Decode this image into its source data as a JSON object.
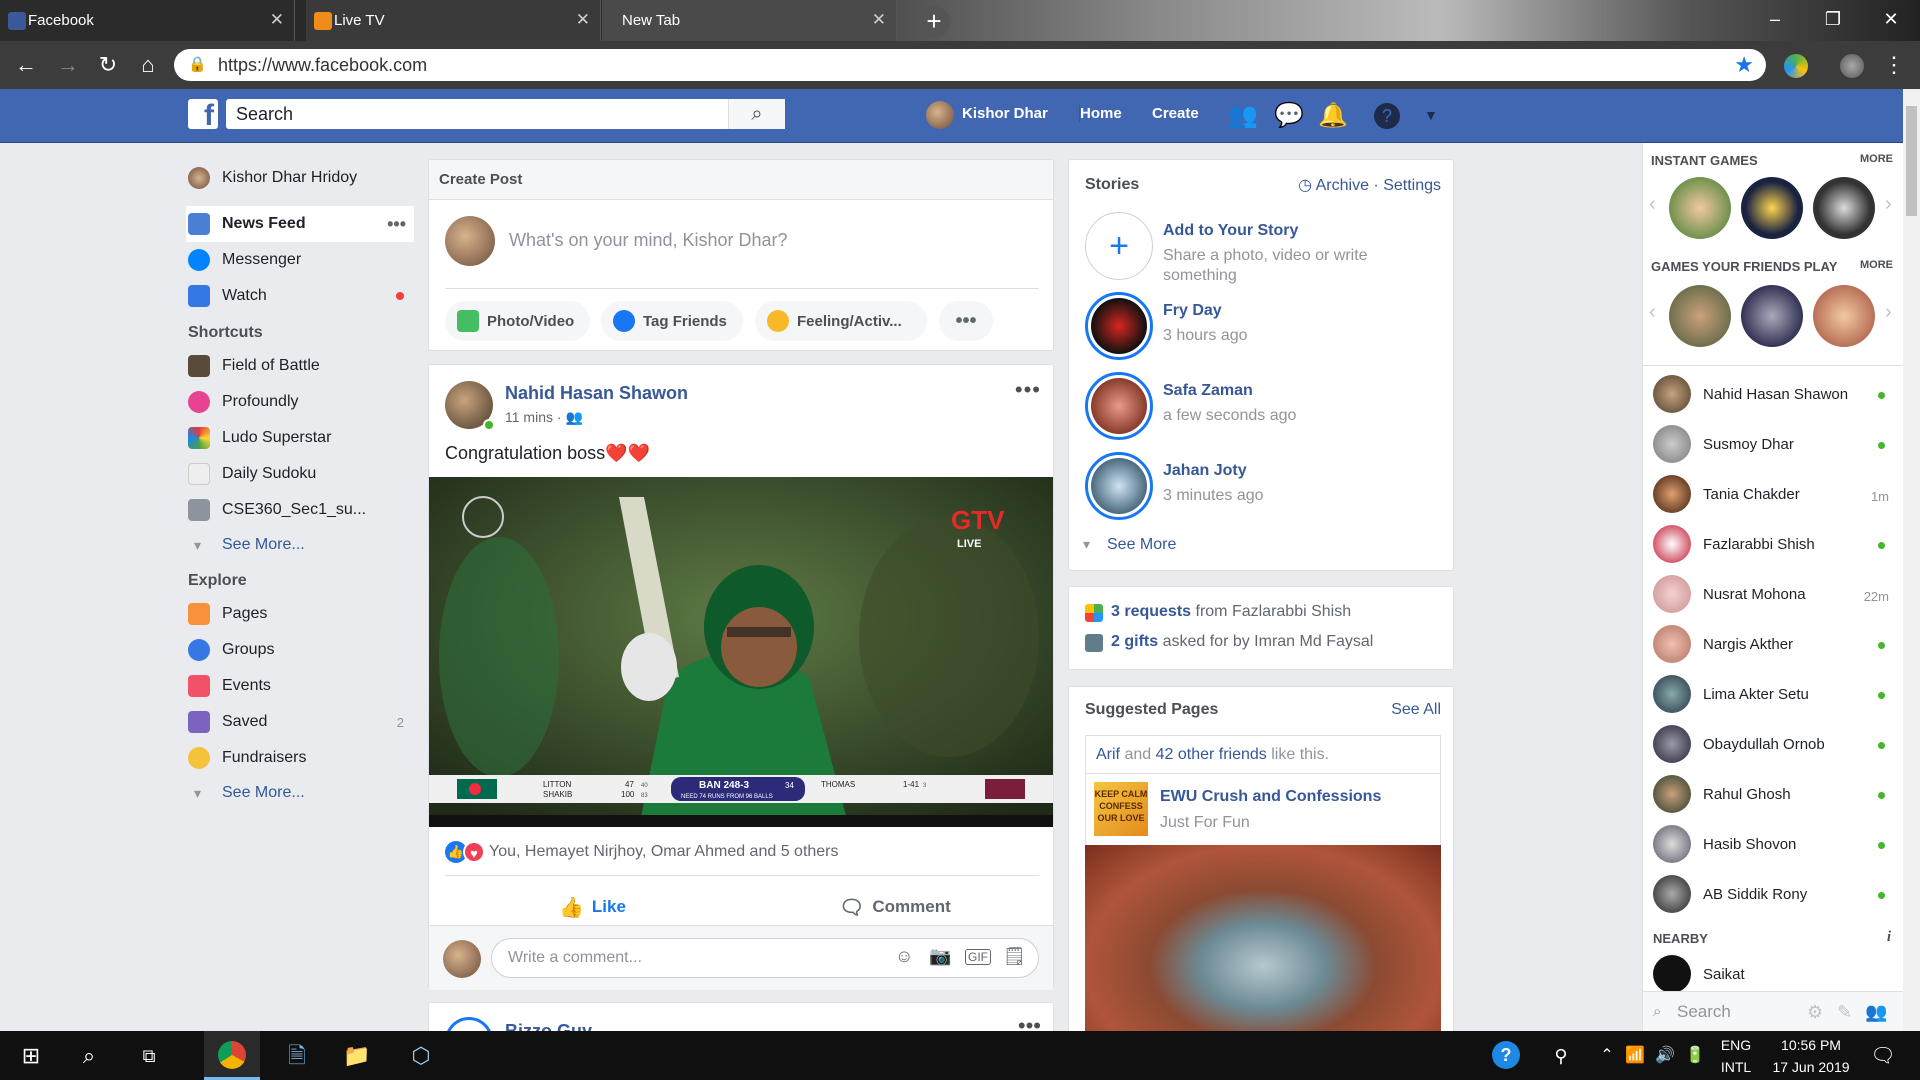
{
  "browser": {
    "tabs": [
      {
        "title": "Facebook",
        "active": true
      },
      {
        "title": "Live TV",
        "active": false
      },
      {
        "title": "New Tab",
        "active": false
      }
    ],
    "url": "https://www.facebook.com"
  },
  "header": {
    "search_placeholder": "Search",
    "user_name": "Kishor Dhar",
    "home": "Home",
    "create": "Create"
  },
  "leftnav": {
    "profile": "Kishor Dhar Hridoy",
    "main": [
      {
        "label": "News Feed",
        "icon": "news-feed-icon"
      },
      {
        "label": "Messenger",
        "icon": "messenger-icon"
      },
      {
        "label": "Watch",
        "icon": "watch-icon"
      }
    ],
    "shortcuts_title": "Shortcuts",
    "shortcuts": [
      "Field of Battle",
      "Profoundly",
      "Ludo Superstar",
      "Daily Sudoku",
      "CSE360_Sec1_su..."
    ],
    "see_more": "See More...",
    "explore_title": "Explore",
    "explore": [
      "Pages",
      "Groups",
      "Events",
      "Saved",
      "Fundraisers"
    ],
    "saved_count": "2"
  },
  "create_post": {
    "title": "Create Post",
    "placeholder": "What's on your mind, Kishor Dhar?",
    "buttons": [
      "Photo/Video",
      "Tag Friends",
      "Feeling/Activ..."
    ]
  },
  "post": {
    "author": "Nahid Hasan Shawon",
    "time": "11 mins",
    "text": "Congratulation boss❤️❤️",
    "reactions": "You, Hemayet Nirjhoy, Omar Ahmed and 5 others",
    "like": "Like",
    "comment": "Comment",
    "comment_placeholder": "Write a comment...",
    "scoreboard": {
      "batsman1": "LITTON",
      "b1_runs": "47",
      "b1_balls": "40",
      "batsman2": "SHAKIB",
      "b2_runs": "100",
      "b2_balls": "83",
      "score": "BAN 248-3",
      "overs": "34",
      "target": "NEED 74 RUNS FROM 96 BALLS",
      "bowler": "THOMAS",
      "bowler_fig": "1-41",
      "bowler_overs": "3"
    },
    "tv_logo": "GTV",
    "tv_live": "LIVE"
  },
  "post2": {
    "author": "Bizzo Guy"
  },
  "stories": {
    "title": "Stories",
    "archive": "Archive",
    "settings": "Settings",
    "add_title": "Add to Your Story",
    "add_sub": "Share a photo, video or write something",
    "items": [
      {
        "name": "Fry Day",
        "time": "3 hours ago"
      },
      {
        "name": "Safa Zaman",
        "time": "a few seconds ago"
      },
      {
        "name": "Jahan Joty",
        "time": "3 minutes ago"
      }
    ],
    "see_more": "See More"
  },
  "requests": {
    "req_count": "3 requests",
    "req_from": "from Fazlarabbi Shish",
    "gift_count": "2 gifts",
    "gift_from": "asked for by Imran Md Faysal"
  },
  "suggested": {
    "title": "Suggested Pages",
    "see_all": "See All",
    "friend": "Arif",
    "and_others": "and",
    "others_link": "42 other friends",
    "like_this": "like this.",
    "page_name": "EWU Crush and Confessions",
    "page_sub": "Just For Fun",
    "thumb_text": "KEEP CALM CONFESS OUR LOVE"
  },
  "rightbar": {
    "instant_games": "INSTANT GAMES",
    "friends_games": "GAMES YOUR FRIENDS PLAY",
    "more": "MORE",
    "nearby": "NEARBY",
    "contacts": [
      {
        "name": "Nahid Hasan Shawon",
        "status": ""
      },
      {
        "name": "Susmoy Dhar",
        "status": ""
      },
      {
        "name": "Tania Chakder",
        "status": "1m"
      },
      {
        "name": "Fazlarabbi Shish",
        "status": ""
      },
      {
        "name": "Nusrat Mohona",
        "status": "22m"
      },
      {
        "name": "Nargis Akther",
        "status": ""
      },
      {
        "name": "Lima Akter Setu",
        "status": ""
      },
      {
        "name": "Obaydullah Ornob",
        "status": ""
      },
      {
        "name": "Rahul Ghosh",
        "status": ""
      },
      {
        "name": "Hasib Shovon",
        "status": ""
      },
      {
        "name": "AB Siddik Rony",
        "status": ""
      }
    ],
    "nearby_contact": "Saikat",
    "search_placeholder": "Search"
  },
  "taskbar": {
    "lang1": "ENG",
    "lang2": "INTL",
    "time": "10:56 PM",
    "date": "17 Jun 2019"
  },
  "colors": {
    "fb_blue": "#4267b2",
    "link": "#365899",
    "online": "#42b72a"
  }
}
